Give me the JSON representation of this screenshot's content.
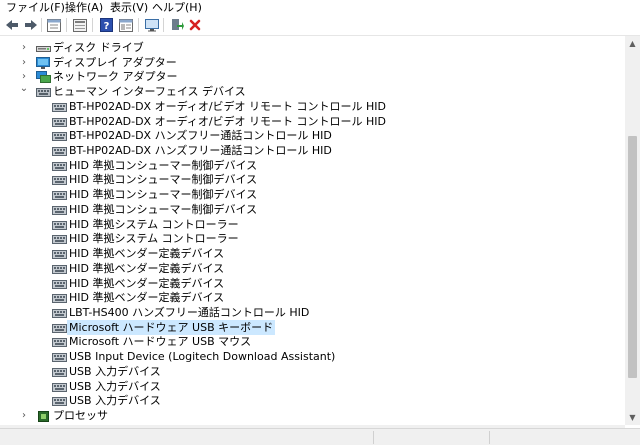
{
  "menu": {
    "items": [
      {
        "label": "ファイル(F)"
      },
      {
        "label": "操作(A)"
      },
      {
        "label": "表示(V)"
      },
      {
        "label": "ヘルプ(H)"
      }
    ]
  },
  "toolbar": {
    "buttons": [
      {
        "icon": "back-arrow-icon"
      },
      {
        "icon": "forward-arrow-icon"
      },
      {
        "icon": "properties-icon"
      },
      {
        "icon": "show-hide-tree-icon"
      },
      {
        "icon": "help-icon"
      },
      {
        "icon": "view-icon"
      },
      {
        "icon": "scan-hardware-icon"
      },
      {
        "icon": "update-driver-icon"
      },
      {
        "icon": "uninstall-device-icon"
      }
    ]
  },
  "tree": {
    "rows": [
      {
        "label": "ディスク ドライブ",
        "level": 1,
        "expander": "collapsed",
        "icon": "disk-drive-icon"
      },
      {
        "label": "ディスプレイ アダプター",
        "level": 1,
        "expander": "collapsed",
        "icon": "display-adapter-icon"
      },
      {
        "label": "ネットワーク アダプター",
        "level": 1,
        "expander": "collapsed",
        "icon": "network-adapter-icon"
      },
      {
        "label": "ヒューマン インターフェイス デバイス",
        "level": 1,
        "expander": "expanded",
        "icon": "hid-icon"
      },
      {
        "label": "BT-HP02AD-DX オーディオ/ビデオ リモート コントロール HID",
        "level": 2,
        "icon": "hid-device-icon"
      },
      {
        "label": "BT-HP02AD-DX オーディオ/ビデオ リモート コントロール HID",
        "level": 2,
        "icon": "hid-device-icon"
      },
      {
        "label": "BT-HP02AD-DX ハンズフリー通話コントロール HID",
        "level": 2,
        "icon": "hid-device-icon"
      },
      {
        "label": "BT-HP02AD-DX ハンズフリー通話コントロール HID",
        "level": 2,
        "icon": "hid-device-icon"
      },
      {
        "label": "HID 準拠コンシューマー制御デバイス",
        "level": 2,
        "icon": "hid-device-icon"
      },
      {
        "label": "HID 準拠コンシューマー制御デバイス",
        "level": 2,
        "icon": "hid-device-icon"
      },
      {
        "label": "HID 準拠コンシューマー制御デバイス",
        "level": 2,
        "icon": "hid-device-icon"
      },
      {
        "label": "HID 準拠コンシューマー制御デバイス",
        "level": 2,
        "icon": "hid-device-icon"
      },
      {
        "label": "HID 準拠システム コントローラー",
        "level": 2,
        "icon": "hid-device-icon"
      },
      {
        "label": "HID 準拠システム コントローラー",
        "level": 2,
        "icon": "hid-device-icon"
      },
      {
        "label": "HID 準拠ベンダー定義デバイス",
        "level": 2,
        "icon": "hid-device-icon"
      },
      {
        "label": "HID 準拠ベンダー定義デバイス",
        "level": 2,
        "icon": "hid-device-icon"
      },
      {
        "label": "HID 準拠ベンダー定義デバイス",
        "level": 2,
        "icon": "hid-device-icon"
      },
      {
        "label": "HID 準拠ベンダー定義デバイス",
        "level": 2,
        "icon": "hid-device-icon"
      },
      {
        "label": "LBT-HS400 ハンズフリー通話コントロール HID",
        "level": 2,
        "icon": "hid-device-icon"
      },
      {
        "label": "Microsoft ハードウェア USB キーボード",
        "level": 2,
        "icon": "hid-device-icon",
        "selected": true
      },
      {
        "label": "Microsoft ハードウェア USB マウス",
        "level": 2,
        "icon": "hid-device-icon"
      },
      {
        "label": "USB Input Device (Logitech Download Assistant)",
        "level": 2,
        "icon": "hid-device-icon"
      },
      {
        "label": "USB 入力デバイス",
        "level": 2,
        "icon": "hid-device-icon"
      },
      {
        "label": "USB 入力デバイス",
        "level": 2,
        "icon": "hid-device-icon"
      },
      {
        "label": "USB 入力デバイス",
        "level": 2,
        "icon": "hid-device-icon"
      },
      {
        "label": "プロセッサ",
        "level": 1,
        "expander": "collapsed",
        "icon": "processor-icon"
      }
    ]
  },
  "colors": {
    "selection": "#cce8ff",
    "uninstall_red": "#d62020",
    "help_blue": "#2b4fae"
  }
}
